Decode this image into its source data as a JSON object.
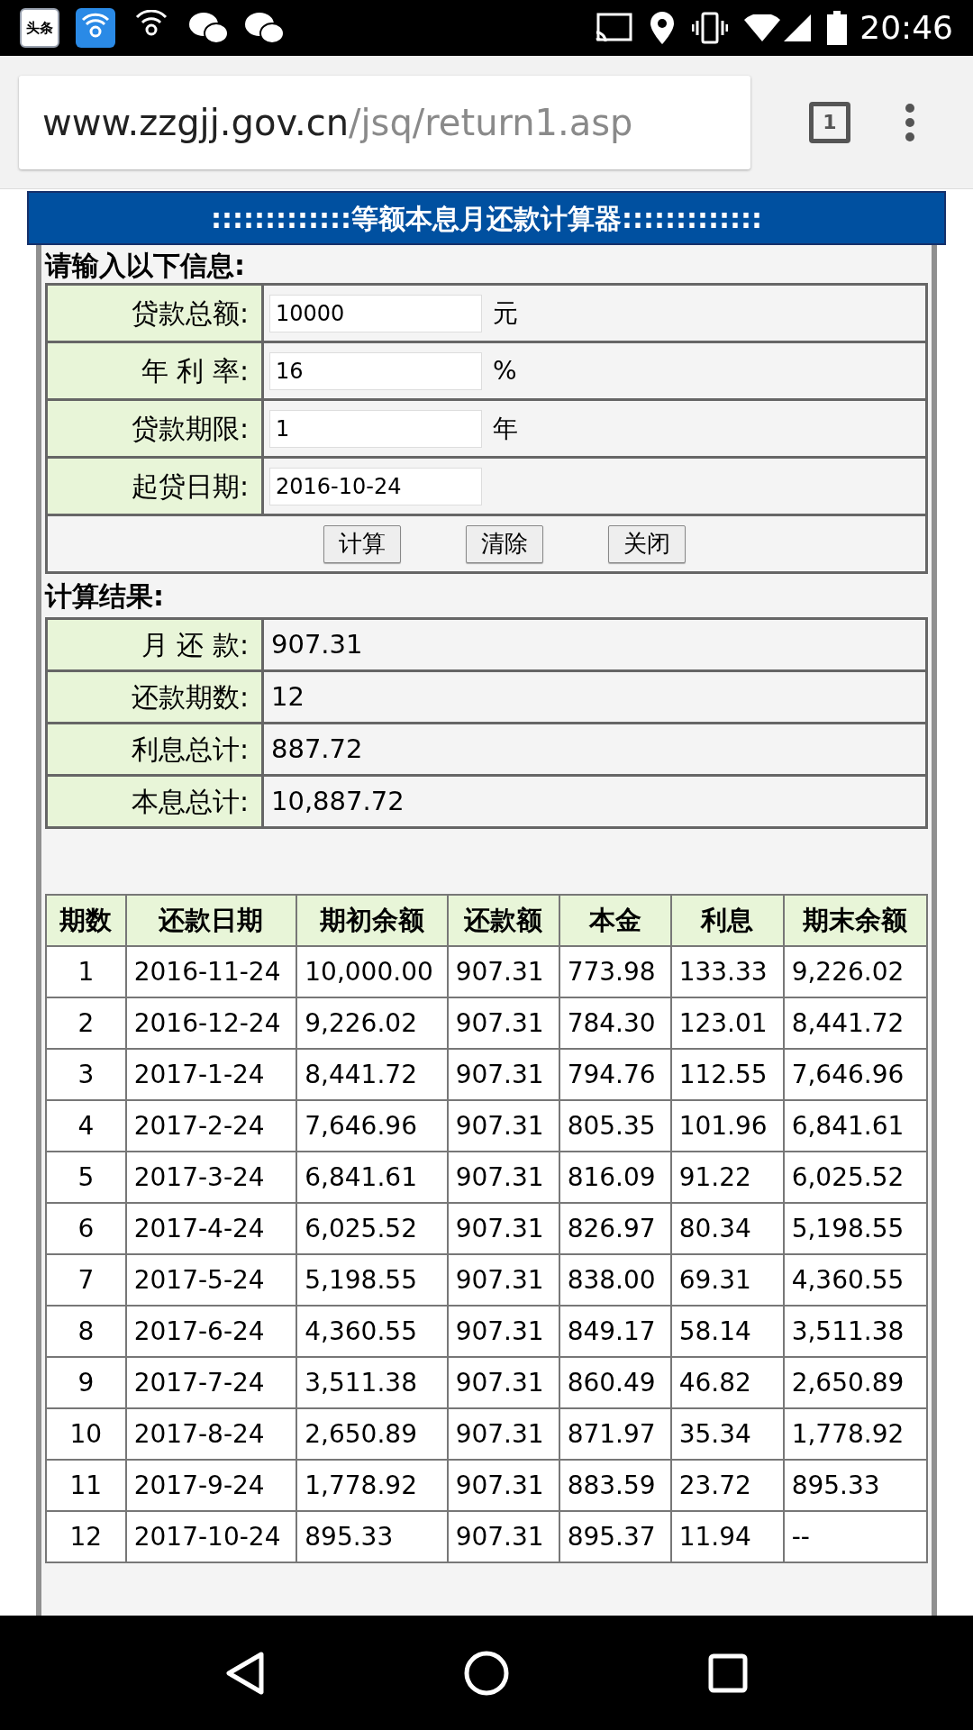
{
  "status_bar": {
    "app_badge": "头条",
    "time": "20:46"
  },
  "browser": {
    "url_host": "www.zzgjj.gov.cn",
    "url_path": "/jsq/return1.asp",
    "tab_count": "1"
  },
  "calculator": {
    "title": ":::::::::::::等额本息月还款计算器:::::::::::::",
    "input_heading": "请输入以下信息:",
    "inputs": [
      {
        "label": "贷款总额:",
        "value": "10000",
        "unit": "元"
      },
      {
        "label": "年 利 率:",
        "value": "16",
        "unit": "%"
      },
      {
        "label": "贷款期限:",
        "value": "1",
        "unit": "年"
      },
      {
        "label": "起贷日期:",
        "value": "2016-10-24"
      }
    ],
    "buttons": [
      "计算",
      "清除",
      "关闭"
    ],
    "result_heading": "计算结果:",
    "results": [
      {
        "label": "月 还 款:",
        "value": "907.31"
      },
      {
        "label": "还款期数:",
        "value": "12"
      },
      {
        "label": "利息总计:",
        "value": "887.72"
      },
      {
        "label": "本息总计:",
        "value": "10,887.72"
      }
    ],
    "table": {
      "columns": [
        "期数",
        "还款日期",
        "期初余额",
        "还款额",
        "本金",
        "利息",
        "期末余额"
      ],
      "rows": [
        [
          "1",
          "2016-11-24",
          "10,000.00",
          "907.31",
          "773.98",
          "133.33",
          "9,226.02"
        ],
        [
          "2",
          "2016-12-24",
          "9,226.02",
          "907.31",
          "784.30",
          "123.01",
          "8,441.72"
        ],
        [
          "3",
          "2017-1-24",
          "8,441.72",
          "907.31",
          "794.76",
          "112.55",
          "7,646.96"
        ],
        [
          "4",
          "2017-2-24",
          "7,646.96",
          "907.31",
          "805.35",
          "101.96",
          "6,841.61"
        ],
        [
          "5",
          "2017-3-24",
          "6,841.61",
          "907.31",
          "816.09",
          "91.22",
          "6,025.52"
        ],
        [
          "6",
          "2017-4-24",
          "6,025.52",
          "907.31",
          "826.97",
          "80.34",
          "5,198.55"
        ],
        [
          "7",
          "2017-5-24",
          "5,198.55",
          "907.31",
          "838.00",
          "69.31",
          "4,360.55"
        ],
        [
          "8",
          "2017-6-24",
          "4,360.55",
          "907.31",
          "849.17",
          "58.14",
          "3,511.38"
        ],
        [
          "9",
          "2017-7-24",
          "3,511.38",
          "907.31",
          "860.49",
          "46.82",
          "2,650.89"
        ],
        [
          "10",
          "2017-8-24",
          "2,650.89",
          "907.31",
          "871.97",
          "35.34",
          "1,778.92"
        ],
        [
          "11",
          "2017-9-24",
          "1,778.92",
          "907.31",
          "883.59",
          "23.72",
          "895.33"
        ],
        [
          "12",
          "2017-10-24",
          "895.33",
          "907.31",
          "895.37",
          "11.94",
          "--"
        ]
      ]
    }
  }
}
